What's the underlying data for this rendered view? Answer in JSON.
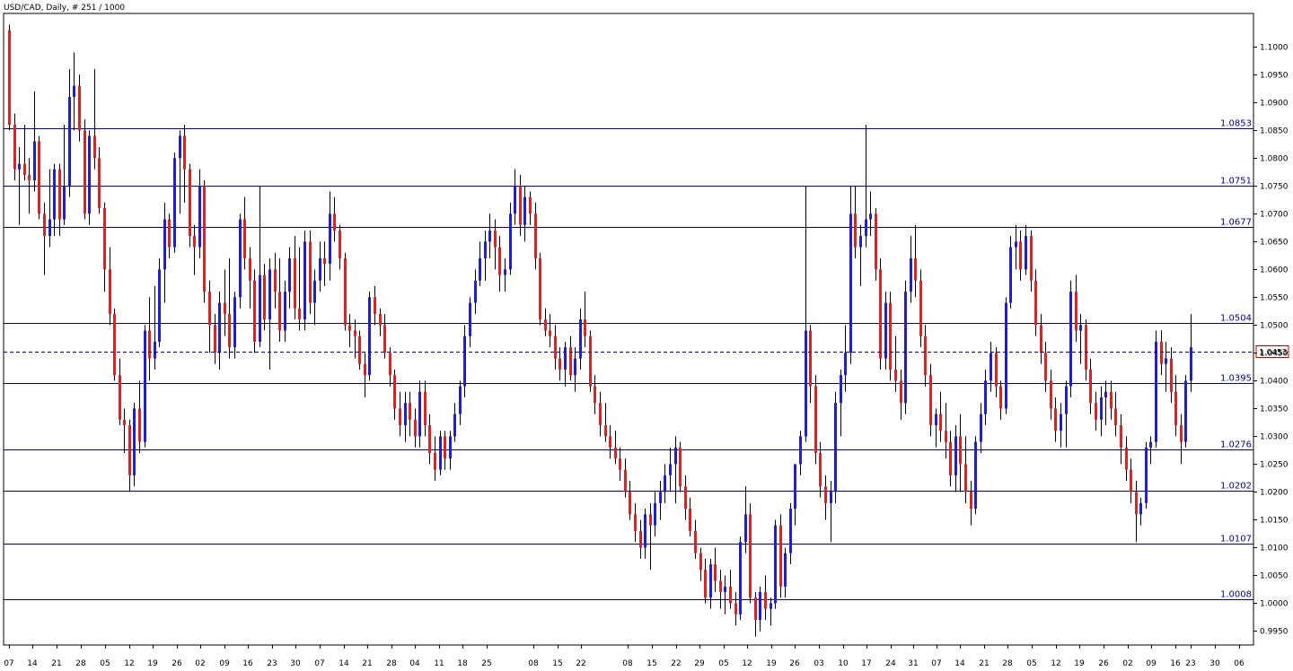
{
  "chart_header": {
    "title": "USD/CAD, Daily, # 251 / 1000"
  },
  "colors": {
    "bull": "#1f1fcc",
    "bear": "#dd2222",
    "wick": "#000000",
    "level": "#000099",
    "grid": "#000000"
  },
  "chart_data": {
    "type": "candlestick",
    "ylim": [
      0.9925,
      1.106
    ],
    "y_ticks": [
      "1.1000",
      "1.0950",
      "1.0900",
      "1.0850",
      "1.0800",
      "1.0750",
      "1.0700",
      "1.0650",
      "1.0600",
      "1.0550",
      "1.0500",
      "1.0450",
      "1.0400",
      "1.0350",
      "1.0300",
      "1.0250",
      "1.0200",
      "1.0150",
      "1.0100",
      "1.0050",
      "1.0000",
      "0.9950"
    ],
    "x_ticks": [
      "07",
      "14",
      "21",
      "28",
      "05",
      "12",
      "19",
      "26",
      "02",
      "09",
      "16",
      "23",
      "30",
      "07",
      "14",
      "21",
      "28",
      "04",
      "11",
      "18",
      "25",
      "08",
      "15",
      "22",
      "08",
      "15",
      "22",
      "29",
      "05",
      "12",
      "19",
      "26",
      "03",
      "10",
      "17",
      "24",
      "31",
      "07",
      "14",
      "21",
      "28",
      "05",
      "12",
      "19",
      "26",
      "02",
      "09",
      "16",
      "23",
      "30",
      "06"
    ],
    "levels": [
      "1.0853",
      "1.0751",
      "1.0677",
      "1.0504",
      "1.0395",
      "1.0276",
      "1.0202",
      "1.0107",
      "1.0008"
    ],
    "current_price": "1.0453",
    "current_price_value": 1.0453,
    "candles": [
      [
        1.103,
        1.104,
        1.085,
        1.086
      ],
      [
        1.086,
        1.088,
        1.076,
        1.078
      ],
      [
        1.078,
        1.082,
        1.068,
        1.079
      ],
      [
        1.079,
        1.086,
        1.076,
        1.077
      ],
      [
        1.077,
        1.08,
        1.07,
        1.076
      ],
      [
        1.076,
        1.092,
        1.074,
        1.083
      ],
      [
        1.083,
        1.084,
        1.069,
        1.07
      ],
      [
        1.07,
        1.072,
        1.059,
        1.066
      ],
      [
        1.066,
        1.078,
        1.064,
        1.069
      ],
      [
        1.069,
        1.079,
        1.066,
        1.078
      ],
      [
        1.078,
        1.079,
        1.066,
        1.069
      ],
      [
        1.069,
        1.086,
        1.068,
        1.075
      ],
      [
        1.075,
        1.096,
        1.073,
        1.091
      ],
      [
        1.091,
        1.099,
        1.085,
        1.093
      ],
      [
        1.093,
        1.095,
        1.083,
        1.085
      ],
      [
        1.085,
        1.087,
        1.069,
        1.07
      ],
      [
        1.07,
        1.085,
        1.068,
        1.084
      ],
      [
        1.084,
        1.096,
        1.078,
        1.08
      ],
      [
        1.08,
        1.082,
        1.07,
        1.071
      ],
      [
        1.071,
        1.072,
        1.056,
        1.06
      ],
      [
        1.06,
        1.064,
        1.05,
        1.052
      ],
      [
        1.052,
        1.053,
        1.04,
        1.041
      ],
      [
        1.041,
        1.044,
        1.032,
        1.033
      ],
      [
        1.033,
        1.035,
        1.027,
        1.032
      ],
      [
        1.032,
        1.033,
        1.02,
        1.023
      ],
      [
        1.023,
        1.036,
        1.021,
        1.035
      ],
      [
        1.035,
        1.04,
        1.027,
        1.029
      ],
      [
        1.029,
        1.05,
        1.028,
        1.049
      ],
      [
        1.049,
        1.055,
        1.04,
        1.044
      ],
      [
        1.044,
        1.057,
        1.042,
        1.047
      ],
      [
        1.047,
        1.062,
        1.046,
        1.06
      ],
      [
        1.06,
        1.072,
        1.054,
        1.069
      ],
      [
        1.069,
        1.07,
        1.062,
        1.064
      ],
      [
        1.064,
        1.081,
        1.063,
        1.08
      ],
      [
        1.08,
        1.085,
        1.07,
        1.084
      ],
      [
        1.084,
        1.086,
        1.072,
        1.078
      ],
      [
        1.078,
        1.079,
        1.064,
        1.066
      ],
      [
        1.066,
        1.068,
        1.059,
        1.064
      ],
      [
        1.064,
        1.078,
        1.062,
        1.075
      ],
      [
        1.075,
        1.076,
        1.054,
        1.056
      ],
      [
        1.056,
        1.058,
        1.045,
        1.05
      ],
      [
        1.05,
        1.052,
        1.043,
        1.045
      ],
      [
        1.045,
        1.056,
        1.042,
        1.054
      ],
      [
        1.054,
        1.06,
        1.048,
        1.052
      ],
      [
        1.052,
        1.062,
        1.044,
        1.046
      ],
      [
        1.046,
        1.056,
        1.044,
        1.055
      ],
      [
        1.055,
        1.07,
        1.053,
        1.069
      ],
      [
        1.069,
        1.073,
        1.06,
        1.062
      ],
      [
        1.062,
        1.064,
        1.053,
        1.058
      ],
      [
        1.058,
        1.06,
        1.045,
        1.047
      ],
      [
        1.047,
        1.075,
        1.046,
        1.059
      ],
      [
        1.059,
        1.061,
        1.049,
        1.051
      ],
      [
        1.051,
        1.062,
        1.042,
        1.06
      ],
      [
        1.06,
        1.063,
        1.053,
        1.056
      ],
      [
        1.056,
        1.062,
        1.047,
        1.049
      ],
      [
        1.049,
        1.058,
        1.047,
        1.056
      ],
      [
        1.056,
        1.064,
        1.053,
        1.062
      ],
      [
        1.062,
        1.066,
        1.051,
        1.053
      ],
      [
        1.053,
        1.064,
        1.049,
        1.051
      ],
      [
        1.051,
        1.067,
        1.049,
        1.065
      ],
      [
        1.065,
        1.067,
        1.052,
        1.054
      ],
      [
        1.054,
        1.06,
        1.05,
        1.058
      ],
      [
        1.058,
        1.065,
        1.056,
        1.062
      ],
      [
        1.062,
        1.065,
        1.057,
        1.061
      ],
      [
        1.061,
        1.074,
        1.058,
        1.07
      ],
      [
        1.07,
        1.073,
        1.065,
        1.067
      ],
      [
        1.067,
        1.068,
        1.06,
        1.062
      ],
      [
        1.062,
        1.063,
        1.049,
        1.05
      ],
      [
        1.05,
        1.052,
        1.046,
        1.049
      ],
      [
        1.049,
        1.051,
        1.044,
        1.048
      ],
      [
        1.048,
        1.049,
        1.042,
        1.043
      ],
      [
        1.043,
        1.045,
        1.037,
        1.041
      ],
      [
        1.041,
        1.056,
        1.04,
        1.055
      ],
      [
        1.055,
        1.057,
        1.05,
        1.052
      ],
      [
        1.052,
        1.053,
        1.048,
        1.05
      ],
      [
        1.05,
        1.052,
        1.044,
        1.045
      ],
      [
        1.045,
        1.046,
        1.039,
        1.041
      ],
      [
        1.041,
        1.042,
        1.033,
        1.035
      ],
      [
        1.035,
        1.038,
        1.03,
        1.032
      ],
      [
        1.032,
        1.038,
        1.029,
        1.036
      ],
      [
        1.036,
        1.038,
        1.03,
        1.033
      ],
      [
        1.033,
        1.035,
        1.028,
        1.03
      ],
      [
        1.03,
        1.04,
        1.028,
        1.038
      ],
      [
        1.038,
        1.04,
        1.03,
        1.032
      ],
      [
        1.032,
        1.034,
        1.025,
        1.027
      ],
      [
        1.027,
        1.03,
        1.022,
        1.024
      ],
      [
        1.024,
        1.031,
        1.023,
        1.03
      ],
      [
        1.03,
        1.031,
        1.024,
        1.026
      ],
      [
        1.026,
        1.031,
        1.024,
        1.03
      ],
      [
        1.03,
        1.036,
        1.029,
        1.034
      ],
      [
        1.034,
        1.04,
        1.032,
        1.039
      ],
      [
        1.039,
        1.05,
        1.037,
        1.048
      ],
      [
        1.048,
        1.055,
        1.046,
        1.054
      ],
      [
        1.054,
        1.06,
        1.052,
        1.058
      ],
      [
        1.058,
        1.065,
        1.057,
        1.062
      ],
      [
        1.062,
        1.067,
        1.058,
        1.065
      ],
      [
        1.065,
        1.07,
        1.062,
        1.067
      ],
      [
        1.067,
        1.069,
        1.06,
        1.064
      ],
      [
        1.064,
        1.066,
        1.056,
        1.059
      ],
      [
        1.059,
        1.062,
        1.056,
        1.06
      ],
      [
        1.06,
        1.072,
        1.059,
        1.07
      ],
      [
        1.07,
        1.078,
        1.068,
        1.075
      ],
      [
        1.075,
        1.077,
        1.066,
        1.068
      ],
      [
        1.068,
        1.075,
        1.065,
        1.073
      ],
      [
        1.073,
        1.074,
        1.068,
        1.07
      ],
      [
        1.07,
        1.072,
        1.06,
        1.062
      ],
      [
        1.062,
        1.063,
        1.05,
        1.051
      ],
      [
        1.051,
        1.053,
        1.048,
        1.049
      ],
      [
        1.049,
        1.052,
        1.046,
        1.048
      ],
      [
        1.048,
        1.05,
        1.042,
        1.044
      ],
      [
        1.044,
        1.046,
        1.04,
        1.042
      ],
      [
        1.042,
        1.047,
        1.039,
        1.046
      ],
      [
        1.046,
        1.048,
        1.04,
        1.041
      ],
      [
        1.041,
        1.046,
        1.038,
        1.044
      ],
      [
        1.044,
        1.053,
        1.042,
        1.051
      ],
      [
        1.051,
        1.056,
        1.046,
        1.048
      ],
      [
        1.048,
        1.049,
        1.038,
        1.039
      ],
      [
        1.039,
        1.041,
        1.034,
        1.036
      ],
      [
        1.036,
        1.038,
        1.03,
        1.032
      ],
      [
        1.032,
        1.036,
        1.029,
        1.03
      ],
      [
        1.03,
        1.032,
        1.026,
        1.028
      ],
      [
        1.028,
        1.031,
        1.025,
        1.026
      ],
      [
        1.026,
        1.028,
        1.022,
        1.024
      ],
      [
        1.024,
        1.026,
        1.019,
        1.02
      ],
      [
        1.02,
        1.022,
        1.015,
        1.016
      ],
      [
        1.016,
        1.018,
        1.011,
        1.013
      ],
      [
        1.013,
        1.015,
        1.008,
        1.01
      ],
      [
        1.01,
        1.017,
        1.008,
        1.016
      ],
      [
        1.016,
        1.018,
        1.006,
        1.014
      ],
      [
        1.014,
        1.02,
        1.012,
        1.018
      ],
      [
        1.018,
        1.022,
        1.015,
        1.02
      ],
      [
        1.02,
        1.025,
        1.018,
        1.023
      ],
      [
        1.023,
        1.028,
        1.02,
        1.025
      ],
      [
        1.025,
        1.03,
        1.018,
        1.028
      ],
      [
        1.028,
        1.029,
        1.02,
        1.021
      ],
      [
        1.021,
        1.023,
        1.015,
        1.017
      ],
      [
        1.017,
        1.019,
        1.012,
        1.013
      ],
      [
        1.013,
        1.015,
        1.008,
        1.009
      ],
      [
        1.009,
        1.01,
        1.004,
        1.006
      ],
      [
        1.006,
        1.008,
        1.0,
        1.001
      ],
      [
        1.001,
        1.008,
        0.999,
        1.007
      ],
      [
        1.007,
        1.01,
        1.002,
        1.004
      ],
      [
        1.004,
        1.006,
        0.999,
        1.002
      ],
      [
        1.002,
        1.005,
        0.998,
        1.003
      ],
      [
        1.003,
        1.006,
        0.999,
        1.0
      ],
      [
        1.0,
        1.002,
        0.996,
        0.998
      ],
      [
        0.998,
        1.012,
        0.997,
        1.011
      ],
      [
        1.011,
        1.021,
        1.009,
        1.016
      ],
      [
        1.016,
        1.018,
        1.0,
        1.001
      ],
      [
        1.001,
        1.002,
        0.994,
        0.997
      ],
      [
        0.997,
        1.003,
        0.995,
        1.002
      ],
      [
        1.002,
        1.005,
        0.997,
        0.999
      ],
      [
        0.999,
        1.001,
        0.996,
        1.0
      ],
      [
        1.0,
        1.015,
        0.999,
        1.014
      ],
      [
        1.014,
        1.016,
        1.001,
        1.003
      ],
      [
        1.003,
        1.01,
        1.001,
        1.009
      ],
      [
        1.009,
        1.018,
        1.007,
        1.017
      ],
      [
        1.017,
        1.023,
        1.014,
        1.025
      ],
      [
        1.025,
        1.031,
        1.023,
        1.03
      ],
      [
        1.03,
        1.075,
        1.029,
        1.049
      ],
      [
        1.049,
        1.05,
        1.036,
        1.039
      ],
      [
        1.039,
        1.041,
        1.025,
        1.027
      ],
      [
        1.027,
        1.029,
        1.019,
        1.021
      ],
      [
        1.021,
        1.023,
        1.015,
        1.018
      ],
      [
        1.018,
        1.022,
        1.011,
        1.02
      ],
      [
        1.02,
        1.038,
        1.018,
        1.036
      ],
      [
        1.036,
        1.042,
        1.03,
        1.041
      ],
      [
        1.041,
        1.05,
        1.038,
        1.045
      ],
      [
        1.045,
        1.075,
        1.043,
        1.07
      ],
      [
        1.07,
        1.075,
        1.062,
        1.064
      ],
      [
        1.064,
        1.068,
        1.057,
        1.066
      ],
      [
        1.066,
        1.086,
        1.064,
        1.069
      ],
      [
        1.069,
        1.074,
        1.066,
        1.07
      ],
      [
        1.07,
        1.071,
        1.058,
        1.06
      ],
      [
        1.06,
        1.062,
        1.042,
        1.044
      ],
      [
        1.044,
        1.056,
        1.042,
        1.054
      ],
      [
        1.054,
        1.056,
        1.04,
        1.042
      ],
      [
        1.042,
        1.048,
        1.038,
        1.04
      ],
      [
        1.04,
        1.042,
        1.033,
        1.036
      ],
      [
        1.036,
        1.058,
        1.034,
        1.056
      ],
      [
        1.056,
        1.066,
        1.054,
        1.062
      ],
      [
        1.062,
        1.068,
        1.055,
        1.058
      ],
      [
        1.058,
        1.06,
        1.046,
        1.048
      ],
      [
        1.048,
        1.05,
        1.039,
        1.041
      ],
      [
        1.041,
        1.043,
        1.03,
        1.032
      ],
      [
        1.032,
        1.035,
        1.028,
        1.034
      ],
      [
        1.034,
        1.038,
        1.029,
        1.031
      ],
      [
        1.031,
        1.036,
        1.026,
        1.029
      ],
      [
        1.029,
        1.031,
        1.021,
        1.023
      ],
      [
        1.023,
        1.032,
        1.02,
        1.03
      ],
      [
        1.03,
        1.034,
        1.02,
        1.025
      ],
      [
        1.025,
        1.03,
        1.018,
        1.02
      ],
      [
        1.02,
        1.022,
        1.014,
        1.017
      ],
      [
        1.017,
        1.03,
        1.016,
        1.029
      ],
      [
        1.029,
        1.036,
        1.027,
        1.034
      ],
      [
        1.034,
        1.042,
        1.032,
        1.04
      ],
      [
        1.04,
        1.047,
        1.038,
        1.045
      ],
      [
        1.045,
        1.046,
        1.037,
        1.039
      ],
      [
        1.039,
        1.04,
        1.033,
        1.035
      ],
      [
        1.035,
        1.055,
        1.034,
        1.054
      ],
      [
        1.054,
        1.066,
        1.053,
        1.064
      ],
      [
        1.064,
        1.068,
        1.06,
        1.065
      ],
      [
        1.065,
        1.067,
        1.058,
        1.06
      ],
      [
        1.06,
        1.068,
        1.059,
        1.066
      ],
      [
        1.066,
        1.067,
        1.056,
        1.058
      ],
      [
        1.058,
        1.06,
        1.048,
        1.05
      ],
      [
        1.05,
        1.052,
        1.043,
        1.045
      ],
      [
        1.045,
        1.047,
        1.038,
        1.04
      ],
      [
        1.04,
        1.042,
        1.033,
        1.035
      ],
      [
        1.035,
        1.037,
        1.029,
        1.031
      ],
      [
        1.031,
        1.036,
        1.028,
        1.034
      ],
      [
        1.034,
        1.04,
        1.028,
        1.039
      ],
      [
        1.039,
        1.058,
        1.037,
        1.056
      ],
      [
        1.056,
        1.059,
        1.047,
        1.049
      ],
      [
        1.049,
        1.052,
        1.043,
        1.05
      ],
      [
        1.05,
        1.051,
        1.04,
        1.042
      ],
      [
        1.042,
        1.044,
        1.034,
        1.036
      ],
      [
        1.036,
        1.038,
        1.031,
        1.033
      ],
      [
        1.033,
        1.039,
        1.03,
        1.037
      ],
      [
        1.037,
        1.04,
        1.032,
        1.038
      ],
      [
        1.038,
        1.04,
        1.033,
        1.035
      ],
      [
        1.035,
        1.038,
        1.03,
        1.032
      ],
      [
        1.032,
        1.034,
        1.025,
        1.028
      ],
      [
        1.028,
        1.03,
        1.022,
        1.024
      ],
      [
        1.024,
        1.026,
        1.018,
        1.02
      ],
      [
        1.02,
        1.022,
        1.011,
        1.016
      ],
      [
        1.016,
        1.019,
        1.014,
        1.018
      ],
      [
        1.018,
        1.029,
        1.017,
        1.028
      ],
      [
        1.028,
        1.03,
        1.025,
        1.029
      ],
      [
        1.029,
        1.049,
        1.028,
        1.047
      ],
      [
        1.047,
        1.049,
        1.041,
        1.043
      ],
      [
        1.043,
        1.047,
        1.038,
        1.044
      ],
      [
        1.044,
        1.046,
        1.036,
        1.038
      ],
      [
        1.038,
        1.041,
        1.03,
        1.032
      ],
      [
        1.032,
        1.034,
        1.025,
        1.029
      ],
      [
        1.029,
        1.041,
        1.028,
        1.04
      ],
      [
        1.04,
        1.052,
        1.038,
        1.046
      ]
    ]
  }
}
